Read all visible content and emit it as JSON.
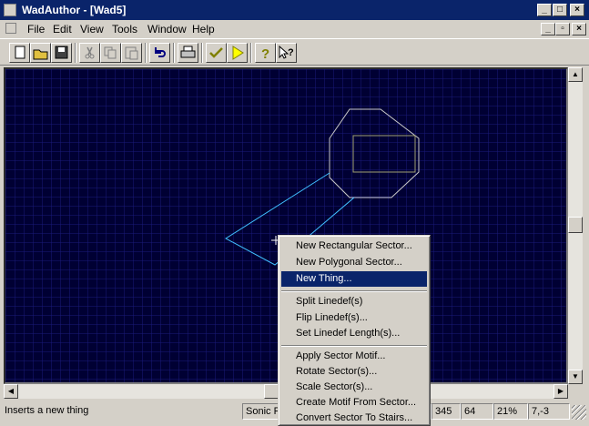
{
  "window": {
    "title": "WadAuthor - [Wad5]"
  },
  "menubar": {
    "items": [
      "File",
      "Edit",
      "View",
      "Tools",
      "Window",
      "Help"
    ]
  },
  "context_menu": {
    "items": [
      "New Rectangular Sector...",
      "New Polygonal Sector...",
      "New Thing...",
      "Split Linedef(s)",
      "Flip Linedef(s)...",
      "Set Linedef Length(s)...",
      "Apply Sector Motif...",
      "Rotate Sector(s)...",
      "Scale Sector(s)...",
      "Create Motif From Sector...",
      "Convert Sector To Stairs..."
    ],
    "selected": "New Thing..."
  },
  "statusbar": {
    "message": "Inserts a new thing",
    "panel2": "Sonic F",
    "panel3": "345",
    "panel4": "64",
    "zoom": "21%",
    "coords": "7,-3"
  },
  "colors": {
    "titlebar": "#0a246a",
    "canvas": "#000033",
    "grid": "#1a1a7a",
    "linedef": "#c8c8c8",
    "selected_linedef": "#40c0ff",
    "highlight": "#0a246a"
  }
}
